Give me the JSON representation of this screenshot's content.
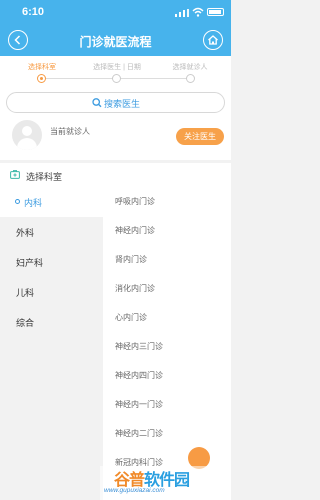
{
  "status_bar": {
    "time": "6:10"
  },
  "nav": {
    "title": "门诊就医流程"
  },
  "steps": [
    {
      "label": "选择科室",
      "active": true
    },
    {
      "label": "选择医生 | 日期",
      "active": false
    },
    {
      "label": "选择就诊人",
      "active": false
    }
  ],
  "search": {
    "label": "搜索医生"
  },
  "patient": {
    "current_label": "当前就诊人",
    "follow_label": "关注医生"
  },
  "section": {
    "title": "选择科室"
  },
  "left_departments": [
    {
      "label": "内科",
      "selected": true
    },
    {
      "label": "外科",
      "selected": false
    },
    {
      "label": "妇产科",
      "selected": false
    },
    {
      "label": "儿科",
      "selected": false
    },
    {
      "label": "综合",
      "selected": false
    }
  ],
  "right_clinics": [
    "呼吸内门诊",
    "神经内门诊",
    "肾内门诊",
    "消化内门诊",
    "心内门诊",
    "神经内三门诊",
    "神经内四门诊",
    "神经内一门诊",
    "神经内二门诊",
    "新冠内科门诊"
  ],
  "watermark": {
    "logo_part1": "谷普",
    "logo_part2": "软件园",
    "url": "www.gupuxiazai.com"
  },
  "colors": {
    "primary": "#47b3ec",
    "accent": "#f79b44",
    "link": "#3b9be0"
  },
  "icons": {
    "back": "chevron-left-icon",
    "home": "home-icon",
    "search": "search-icon",
    "avatar": "user-icon",
    "section": "department-icon",
    "fab": "float-action-icon"
  }
}
